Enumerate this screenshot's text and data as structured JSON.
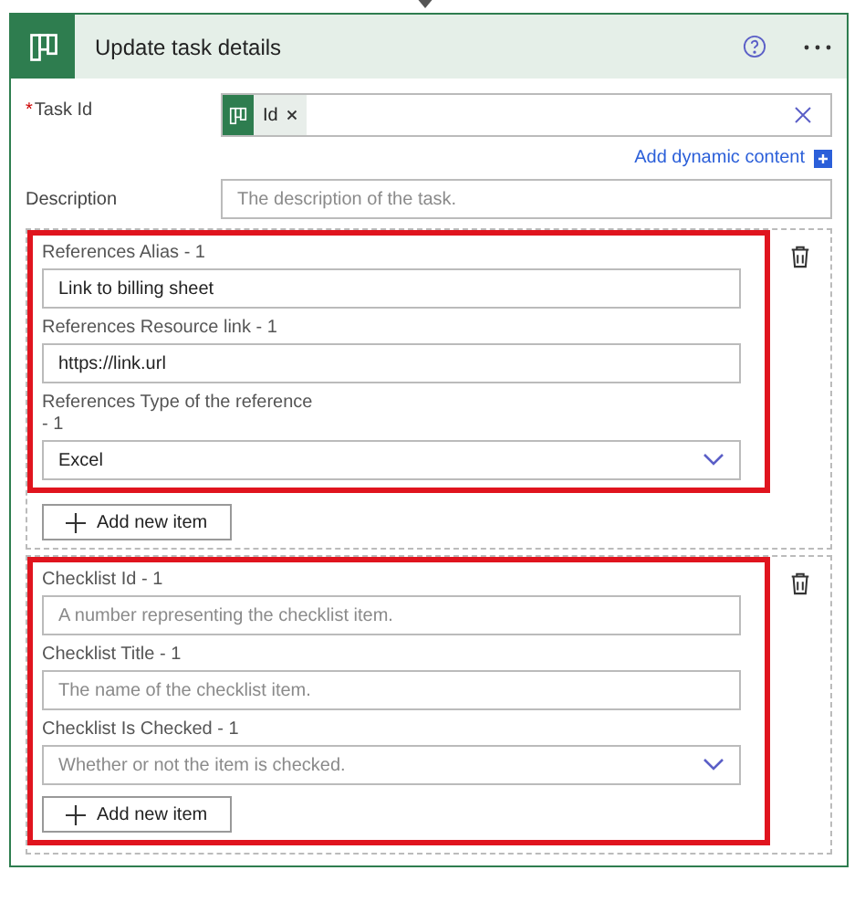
{
  "card": {
    "title": "Update task details"
  },
  "task_id": {
    "label": "Task Id",
    "required_mark": "*",
    "token": "Id",
    "link": "Add dynamic content"
  },
  "description": {
    "label": "Description",
    "placeholder": "The description of the task."
  },
  "sections": [
    {
      "highlighted": true,
      "button_highlighted": false,
      "button": "Add new item",
      "fields": [
        {
          "kind": "text",
          "label": "References Alias - 1",
          "value": "Link to billing sheet"
        },
        {
          "kind": "text",
          "label": "References Resource link - 1",
          "value": "https://link.url"
        },
        {
          "kind": "dropdown",
          "label": "References Type of the reference - 1",
          "value": "Excel"
        }
      ]
    },
    {
      "highlighted": true,
      "button_highlighted": true,
      "button": "Add new item",
      "fields": [
        {
          "kind": "text",
          "label": "Checklist Id - 1",
          "placeholder": "A number representing the checklist item."
        },
        {
          "kind": "text",
          "label": "Checklist Title - 1",
          "placeholder": "The name of the checklist item."
        },
        {
          "kind": "dropdown",
          "label": "Checklist Is Checked - 1",
          "placeholder": "Whether or not the item is checked."
        }
      ]
    }
  ]
}
